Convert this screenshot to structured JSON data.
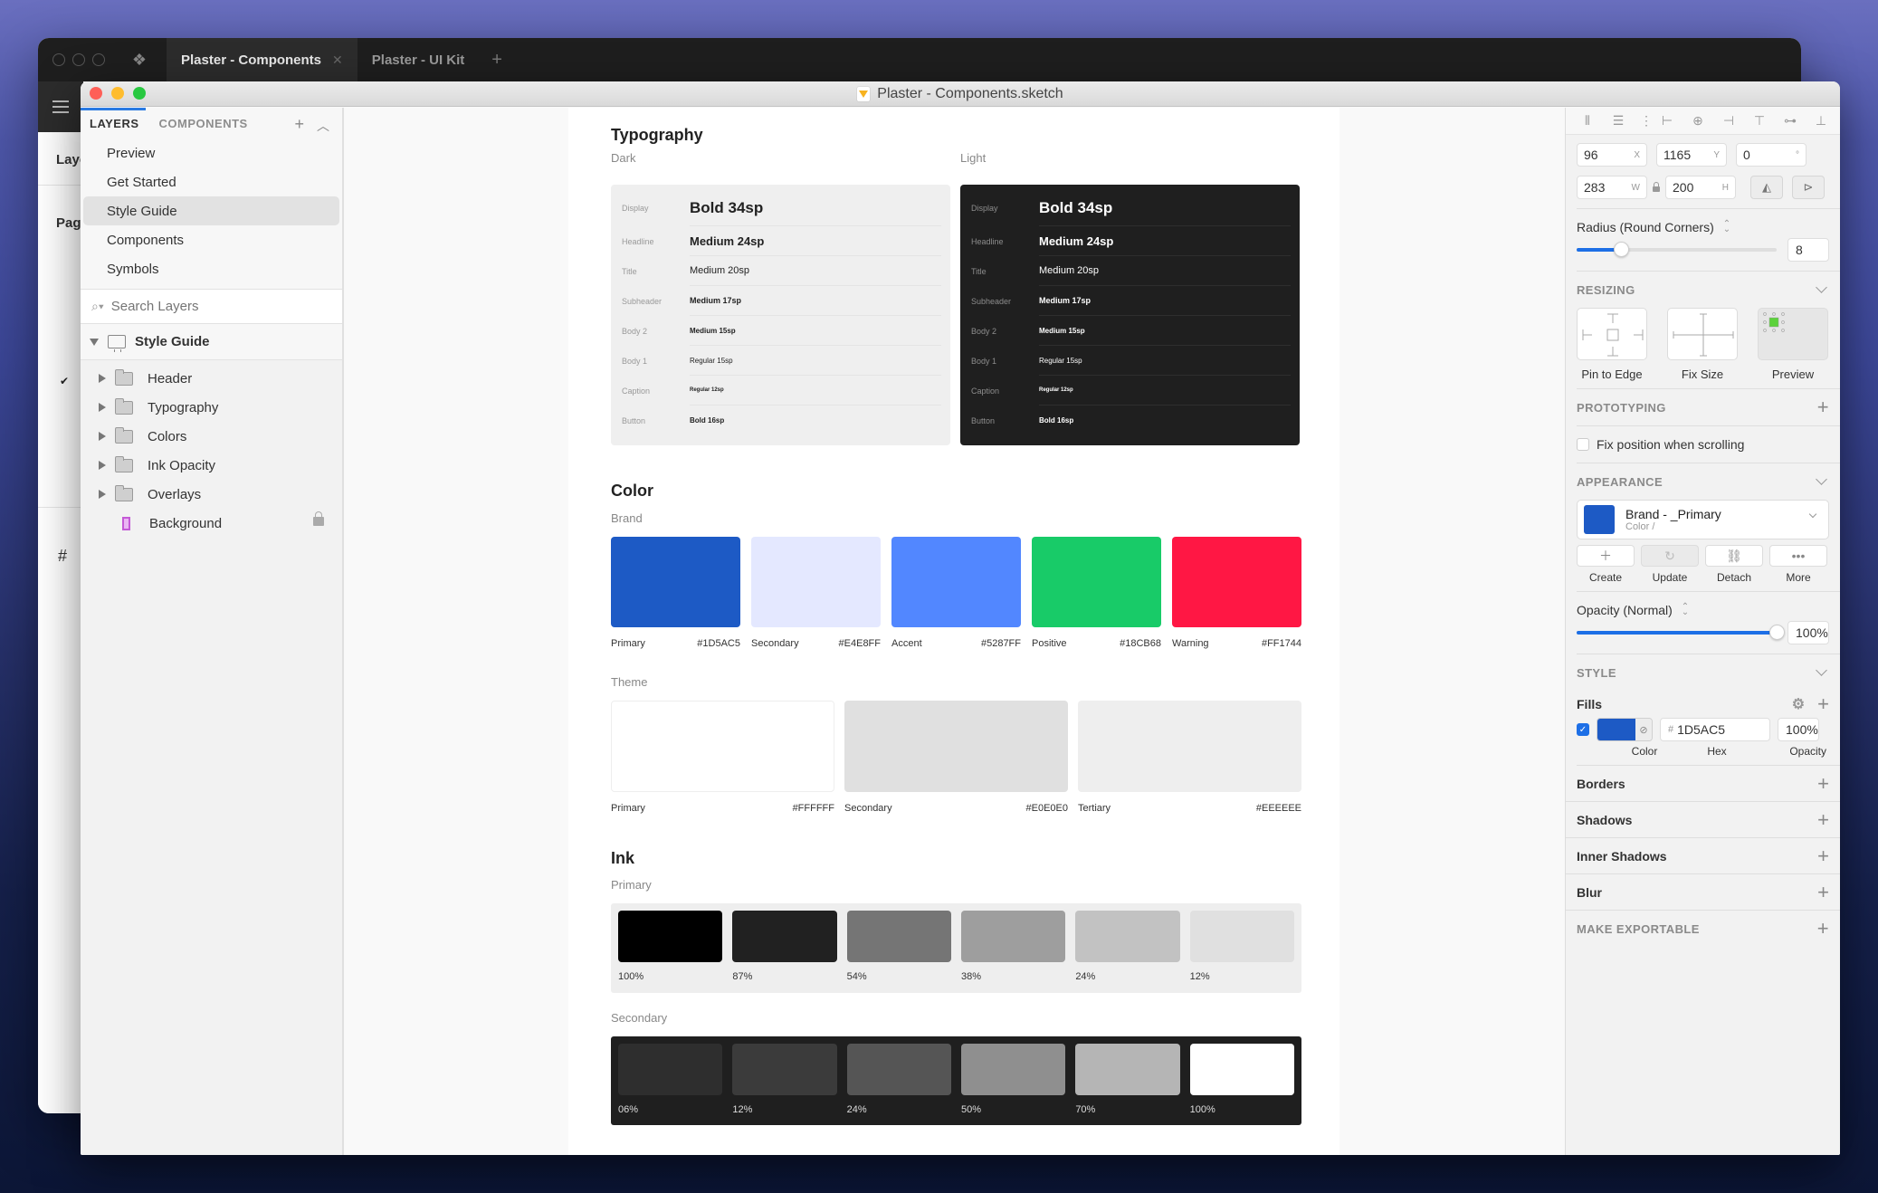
{
  "outer_app": {
    "tabs": [
      {
        "label": "Plaster - Components",
        "active": true
      },
      {
        "label": "Plaster - UI Kit",
        "active": false
      }
    ],
    "side_labels": [
      "Layers",
      "Pages"
    ]
  },
  "window": {
    "title": "Plaster - Components.sketch"
  },
  "left_panel": {
    "tabs": [
      "LAYERS",
      "COMPONENTS"
    ],
    "active_tab": "LAYERS",
    "pages": [
      {
        "label": "Preview",
        "selected": false
      },
      {
        "label": "Get Started",
        "selected": false
      },
      {
        "label": "Style Guide",
        "selected": true
      },
      {
        "label": "Components",
        "selected": false
      },
      {
        "label": "Symbols",
        "selected": false
      }
    ],
    "search_placeholder": "Search Layers",
    "artboard": "Style Guide",
    "layers": [
      {
        "label": "Header",
        "type": "group"
      },
      {
        "label": "Typography",
        "type": "group"
      },
      {
        "label": "Colors",
        "type": "group"
      },
      {
        "label": "Ink Opacity",
        "type": "group"
      },
      {
        "label": "Overlays",
        "type": "group"
      },
      {
        "label": "Background",
        "type": "rectangle",
        "locked": true
      }
    ]
  },
  "canvas": {
    "typography": {
      "title": "Typography",
      "dark_label": "Dark",
      "light_label": "Light",
      "rows": [
        {
          "name": "Display",
          "sample": "Bold 34sp"
        },
        {
          "name": "Headline",
          "sample": "Medium 24sp"
        },
        {
          "name": "Title",
          "sample": "Medium 20sp"
        },
        {
          "name": "Subheader",
          "sample": "Medium 17sp"
        },
        {
          "name": "Body 2",
          "sample": "Medium 15sp"
        },
        {
          "name": "Body 1",
          "sample": "Regular 15sp"
        },
        {
          "name": "Caption",
          "sample": "Regular 12sp"
        },
        {
          "name": "Button",
          "sample": "Bold 16sp"
        }
      ]
    },
    "color": {
      "title": "Color",
      "brand_label": "Brand",
      "brand": [
        {
          "name": "Primary",
          "hex": "#1D5AC5",
          "color": "#1D5AC5"
        },
        {
          "name": "Secondary",
          "hex": "#E4E8FF",
          "color": "#E4E8FF"
        },
        {
          "name": "Accent",
          "hex": "#5287FF",
          "color": "#5287FF"
        },
        {
          "name": "Positive",
          "hex": "#18CB68",
          "color": "#18CB68"
        },
        {
          "name": "Warning",
          "hex": "#FF1744",
          "color": "#FF1744"
        }
      ],
      "theme_label": "Theme",
      "theme": [
        {
          "name": "Primary",
          "hex": "#FFFFFF",
          "color": "#FFFFFF"
        },
        {
          "name": "Secondary",
          "hex": "#E0E0E0",
          "color": "#E0E0E0"
        },
        {
          "name": "Tertiary",
          "hex": "#EEEEEE",
          "color": "#EEEEEE"
        }
      ]
    },
    "ink": {
      "title": "Ink",
      "primary_label": "Primary",
      "primary": [
        {
          "pct": "100%",
          "color": "#000000"
        },
        {
          "pct": "87%",
          "color": "#212121"
        },
        {
          "pct": "54%",
          "color": "#757575"
        },
        {
          "pct": "38%",
          "color": "#9e9e9e"
        },
        {
          "pct": "24%",
          "color": "#c2c2c2"
        },
        {
          "pct": "12%",
          "color": "#e0e0e0"
        }
      ],
      "secondary_label": "Secondary",
      "secondary": [
        {
          "pct": "06%",
          "color": "#2e2e2e"
        },
        {
          "pct": "12%",
          "color": "#3b3b3b"
        },
        {
          "pct": "24%",
          "color": "#555555"
        },
        {
          "pct": "50%",
          "color": "#8f8f8f"
        },
        {
          "pct": "70%",
          "color": "#b5b5b5"
        },
        {
          "pct": "100%",
          "color": "#ffffff"
        }
      ]
    }
  },
  "inspector": {
    "x": "96",
    "x_unit": "X",
    "y": "1165",
    "y_unit": "Y",
    "rotation": "0",
    "rotation_unit": "°",
    "w": "283",
    "w_unit": "W",
    "h": "200",
    "h_unit": "H",
    "radius_label": "Radius (Round Corners)",
    "radius_value": "8",
    "radius_slider_fraction": 0.22,
    "resizing_label": "RESIZING",
    "resizing_options": [
      "Pin to Edge",
      "Fix Size",
      "Preview"
    ],
    "prototyping_label": "PROTOTYPING",
    "fix_position_label": "Fix position when scrolling",
    "fix_position_checked": false,
    "appearance_label": "APPEARANCE",
    "shared_style": {
      "name": "Brand - _Primary",
      "sub": "Color /",
      "color": "#1D5AC5"
    },
    "style_actions": [
      "Create",
      "Update",
      "Detach",
      "More"
    ],
    "opacity_label": "Opacity (Normal)",
    "opacity_value": "100%",
    "opacity_fraction": 1.0,
    "style_label": "STYLE",
    "fills_label": "Fills",
    "fill": {
      "enabled": true,
      "color": "#1D5AC5",
      "hex": "1D5AC5",
      "opacity": "100%"
    },
    "fill_field_labels": [
      "Color",
      "Hex",
      "Opacity"
    ],
    "sections": [
      "Borders",
      "Shadows",
      "Inner Shadows",
      "Blur"
    ],
    "export_label": "MAKE EXPORTABLE"
  },
  "colors": {
    "accent": "#1d6fe6",
    "titlebar_red": "#fe5f57",
    "titlebar_yellow": "#febc2e",
    "titlebar_green": "#28c840"
  }
}
